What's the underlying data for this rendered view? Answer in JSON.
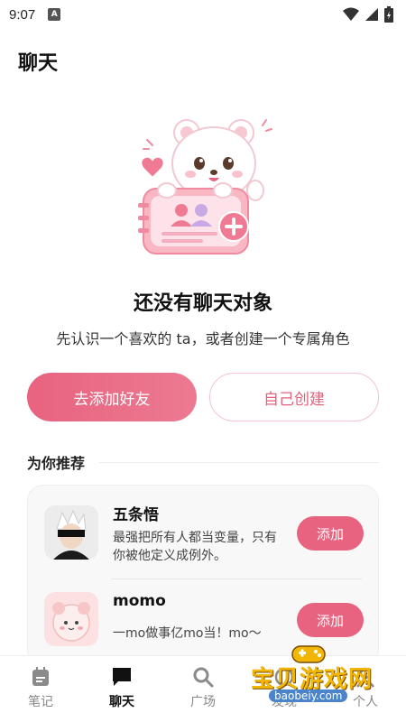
{
  "status": {
    "time": "9:07"
  },
  "header": {
    "title": "聊天"
  },
  "empty": {
    "title": "还没有聊天对象",
    "subtitle": "先认识一个喜欢的 ta，或者创建一个专属角色"
  },
  "actions": {
    "add_friend": "去添加好友",
    "create_own": "自己创建"
  },
  "recommend": {
    "title": "为你推荐",
    "items": [
      {
        "name": "五条悟",
        "desc": "最强把所有人都当变量，只有你被他定义成例外。",
        "button": "添加"
      },
      {
        "name": "momo",
        "desc": "一mo做事亿mo当！mo～",
        "button": "添加"
      }
    ]
  },
  "tabs": [
    {
      "label": "笔记",
      "icon": "notes-icon"
    },
    {
      "label": "聊天",
      "icon": "chat-icon"
    },
    {
      "label": "广场",
      "icon": "search-icon"
    },
    {
      "label": "发现",
      "icon": "discover-icon"
    },
    {
      "label": "个人",
      "icon": "person-icon"
    }
  ],
  "watermark": {
    "text": "宝贝游戏网",
    "url": "baobeiy.com"
  },
  "colors": {
    "accent": "#e8637f",
    "accent_light": "#f4c4cf"
  }
}
